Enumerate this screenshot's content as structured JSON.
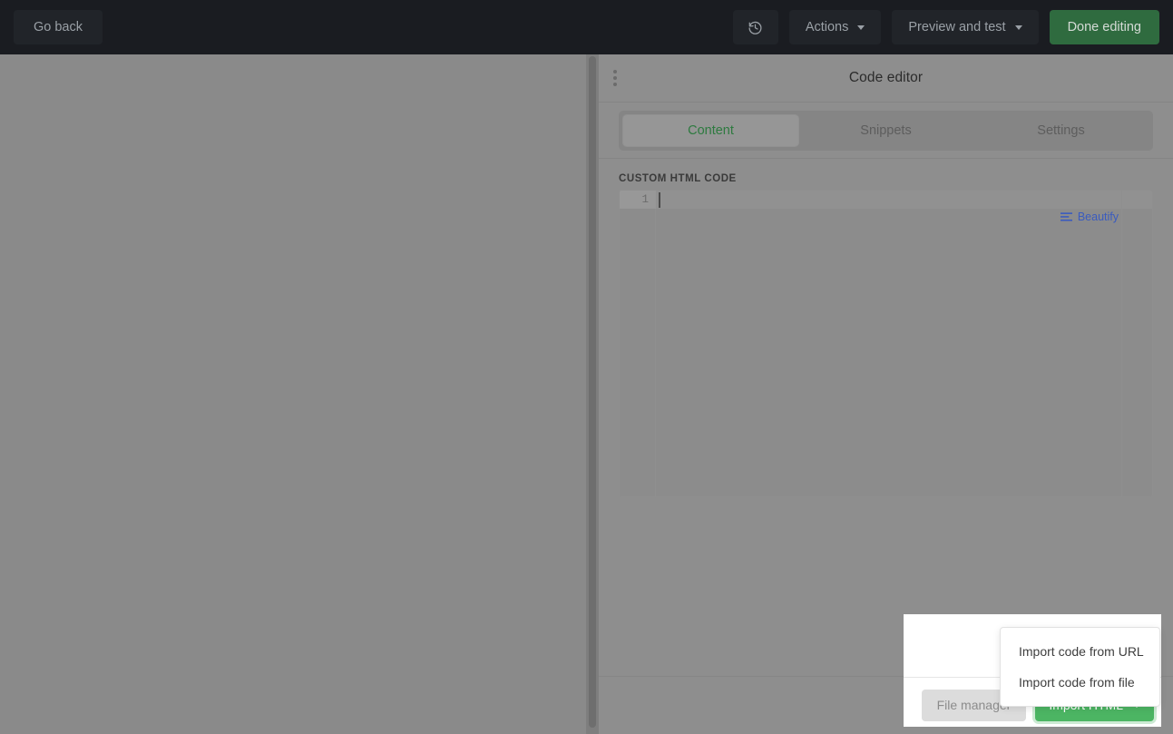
{
  "topbar": {
    "go_back_label": "Go back",
    "history_icon": "history-icon",
    "actions_label": "Actions",
    "preview_label": "Preview and test",
    "done_label": "Done editing",
    "accent_green": "#2f6b3f",
    "background": "#1a1c21"
  },
  "panel": {
    "title": "Code editor",
    "drag_handle_icon": "drag-handle-dots-icon",
    "tabs": [
      {
        "label": "Content",
        "active": true
      },
      {
        "label": "Snippets",
        "active": false
      },
      {
        "label": "Settings",
        "active": false
      }
    ],
    "active_tab_color": "#2d7a3f",
    "field_label": "CUSTOM HTML CODE",
    "editor": {
      "line_number": "1",
      "content": "",
      "beautify_label": "Beautify",
      "beautify_icon": "align-lines-icon",
      "beautify_color": "#3a5bbf"
    }
  },
  "import": {
    "file_manager_label": "File manager",
    "import_html_label": "Import HTML",
    "import_html_caret": "chevron-down-icon",
    "import_html_color": "#4cb563",
    "menu_items": [
      {
        "label": "Import code from URL"
      },
      {
        "label": "Import code from file"
      }
    ]
  }
}
